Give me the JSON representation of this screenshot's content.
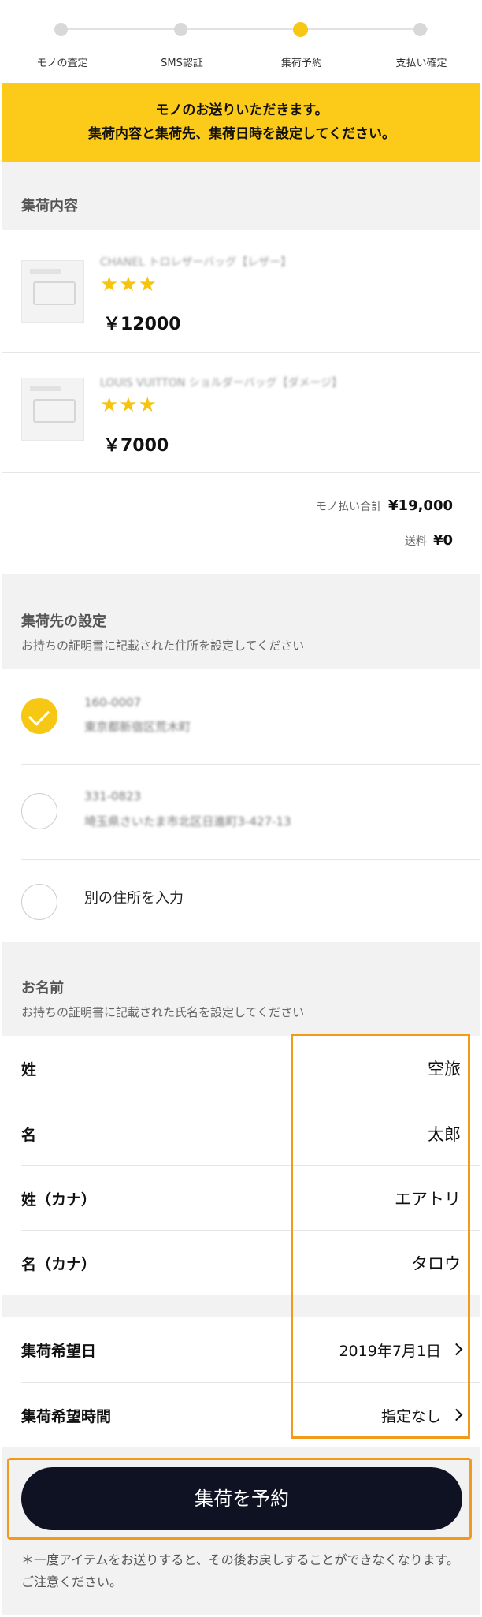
{
  "stepper": {
    "steps": [
      {
        "label": "モノの査定"
      },
      {
        "label": "SMS認証"
      },
      {
        "label": "集荷予約"
      },
      {
        "label": "支払い確定"
      }
    ],
    "active_index": 2
  },
  "banner": {
    "line1": "モノのお送りいただきます。",
    "line2": "集荷内容と集荷先、集荷日時を設定してください。"
  },
  "contents": {
    "title": "集荷内容",
    "items": [
      {
        "name": "CHANEL トロレザーバッグ【レザー】",
        "rating": "★★★",
        "price": "￥12000"
      },
      {
        "name": "LOUIS VUITTON ショルダーバッグ【ダメージ】",
        "rating": "★★★",
        "price": "￥7000"
      }
    ],
    "subtotal_label": "モノ払い合計",
    "subtotal_value": "¥19,000",
    "shipping_label": "送料",
    "shipping_value": "¥0"
  },
  "address": {
    "title": "集荷先の設定",
    "subtitle": "お持ちの証明書に記載された住所を設定してください",
    "options": [
      {
        "line1": "160-0007",
        "line2": "東京都新宿区荒木町",
        "selected": true
      },
      {
        "line1": "331-0823",
        "line2": "埼玉県さいたま市北区日進町3-427-13",
        "selected": false
      }
    ],
    "other_label": "別の住所を入力"
  },
  "name": {
    "title": "お名前",
    "subtitle": "お持ちの証明書に記載された氏名を設定してください",
    "fields": [
      {
        "label": "姓",
        "value": "空旅"
      },
      {
        "label": "名",
        "value": "太郎"
      },
      {
        "label": "姓（カナ）",
        "value": "エアトリ"
      },
      {
        "label": "名（カナ）",
        "value": "タロウ"
      }
    ]
  },
  "schedule": {
    "date_label": "集荷希望日",
    "date_value": "2019年7月1日",
    "time_label": "集荷希望時間",
    "time_value": "指定なし"
  },
  "submit_label": "集荷を予約",
  "note": "＊一度アイテムをお送りすると、その後お戻しすることができなくなります。ご注意ください。",
  "colors": {
    "accent_yellow": "#fccb1a",
    "highlight_orange": "#f39a1c",
    "button_navy": "#0e1222"
  }
}
